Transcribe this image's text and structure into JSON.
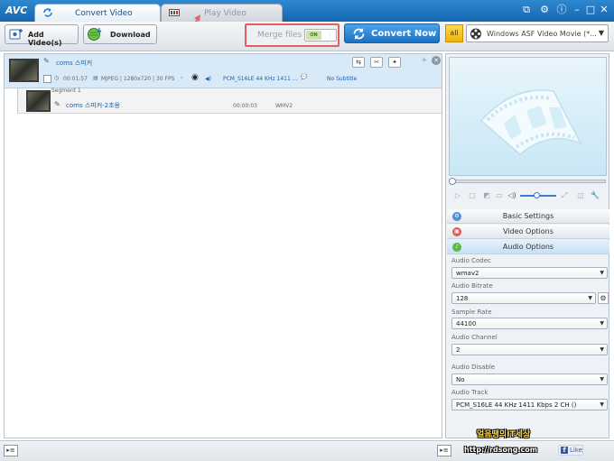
{
  "app": {
    "logo": "AVC"
  },
  "tabs": [
    {
      "label": "Convert Video",
      "active": true
    },
    {
      "label": "Play Video",
      "active": false
    }
  ],
  "window_controls": [
    "restore",
    "settings",
    "info",
    "minimize",
    "maximize",
    "close"
  ],
  "toolbar": {
    "add_videos_label": "Add Video(s)",
    "download_label": "Download",
    "merge_label": "Merge files",
    "merge_toggle": "ON",
    "convert_now_label": "Convert Now",
    "all_label": "all",
    "profile_value": "Windows ASF Video Movie (*...",
    "merge_highlight_color": "#e06060"
  },
  "file": {
    "name": "coms 스피커",
    "duration": "00:01:57",
    "video_info": "MJPEG | 1280x720 | 30 FPS",
    "audio_info": "PCM_S16LE 44 KHz 1411 ...",
    "subtitle": "No Subtitle",
    "segment_header": "Segment 1",
    "segment_name": "coms 스피커-2초용",
    "segment_duration": "00:00:03",
    "segment_format": "WMV2"
  },
  "panel": {
    "sections": [
      "Basic Settings",
      "Video Options",
      "Audio Options"
    ],
    "active_section": "Audio Options",
    "options": [
      {
        "label": "Audio Codec",
        "value": "wmav2"
      },
      {
        "label": "Audio Bitrate",
        "value": "128"
      },
      {
        "label": "Sample Rate",
        "value": "44100"
      },
      {
        "label": "Audio Channel",
        "value": "2"
      },
      {
        "label": "Audio Disable",
        "value": "No"
      },
      {
        "label": "Audio Track",
        "value": "PCM_S16LE 44 KHz 1411 Kbps 2 CH ()"
      }
    ]
  },
  "footer": {
    "watermark_text": "얼음땡의IT세상",
    "watermark_url": "http://rdsong.com",
    "like_label": "Like"
  }
}
